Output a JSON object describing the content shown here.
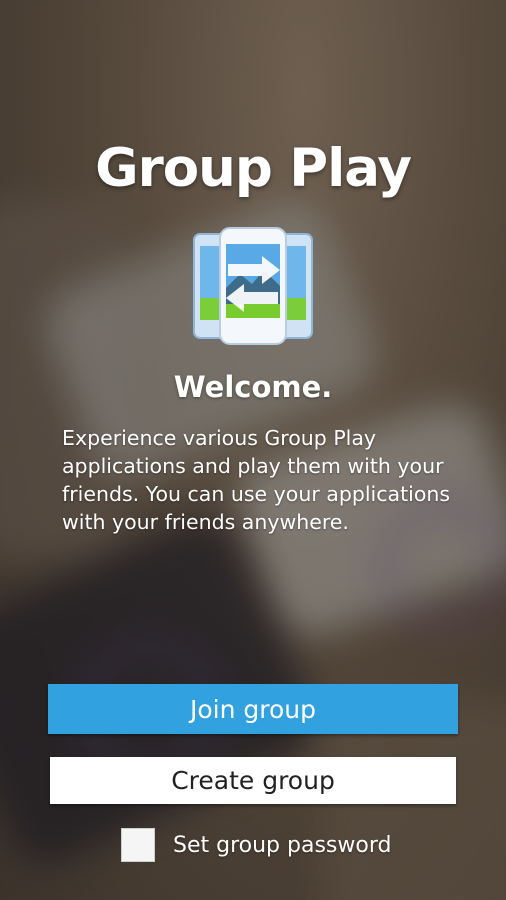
{
  "app": {
    "title": "Group Play",
    "icon": "group-play-app-icon"
  },
  "welcome": {
    "heading": "Welcome.",
    "description": "Experience various Group Play applications and play them with your friends. You can use your applications with your friends anywhere."
  },
  "buttons": {
    "join_label": "Join group",
    "create_label": "Create group"
  },
  "password": {
    "label": "Set group password",
    "checked": false
  },
  "colors": {
    "accent": "#31a1e0",
    "create_button_bg": "#ffffff",
    "text": "#ffffff"
  }
}
